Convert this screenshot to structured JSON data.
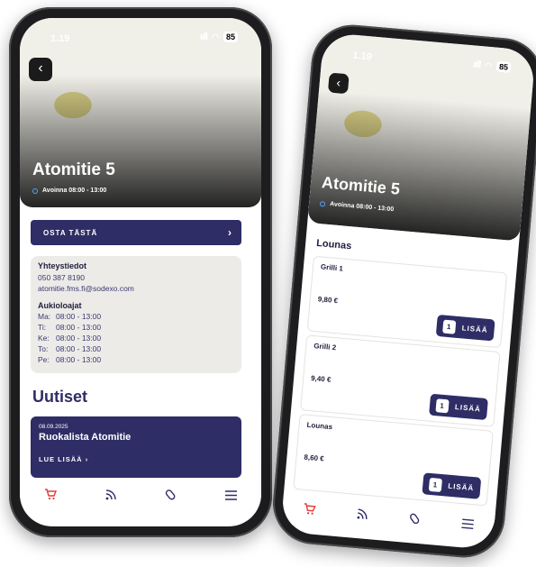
{
  "left_phone": {
    "status": {
      "time": "1.19",
      "signal": "ııll",
      "wifi": "WiFi",
      "battery": "85"
    },
    "back_icon": "‹",
    "restaurant_name": "Atomitie 5",
    "hours": "Avoinna 08:00 - 13:00",
    "buy_button": "OSTA TÄSTÄ",
    "contact": {
      "heading": "Yhteystiedot",
      "phone": "050 387 8190",
      "email": "atomitie.fms.fi@sodexo.com"
    },
    "opening_hours": {
      "heading": "Aukioloajat",
      "rows": [
        {
          "day": "Ma:",
          "time": "08:00 - 13:00"
        },
        {
          "day": "Ti:",
          "time": "08:00 - 13:00"
        },
        {
          "day": "Ke:",
          "time": "08:00 - 13:00"
        },
        {
          "day": "To:",
          "time": "08:00 - 13:00"
        },
        {
          "day": "Pe:",
          "time": "08:00 - 13:00"
        }
      ]
    },
    "news_heading": "Uutiset",
    "news": {
      "date": "08.09.2025",
      "title": "Ruokalista Atomitie",
      "link": "LUE LISÄÄ"
    },
    "tabs": [
      "cart-icon",
      "rss-icon",
      "tag-icon",
      "menu-icon"
    ]
  },
  "right_phone": {
    "status": {
      "time": "1.19",
      "signal": "ııll",
      "battery": "85"
    },
    "back_icon": "‹",
    "restaurant_name": "Atomitie 5",
    "hours": "Avoinna 08:00 - 13:00",
    "section": "Lounas",
    "items": [
      {
        "name": "Grilli 1",
        "price": "9,80 €",
        "qty": "1",
        "add": "LISÄÄ"
      },
      {
        "name": "Grilli 2",
        "price": "9,40 €",
        "qty": "1",
        "add": "LISÄÄ"
      },
      {
        "name": "Lounas",
        "price": "8,60 €",
        "qty": "1",
        "add": "LISÄÄ"
      }
    ]
  },
  "colors": {
    "navy": "#2e2d66",
    "active_tab": "#e23b3b",
    "card_bg": "#ecebe8"
  }
}
